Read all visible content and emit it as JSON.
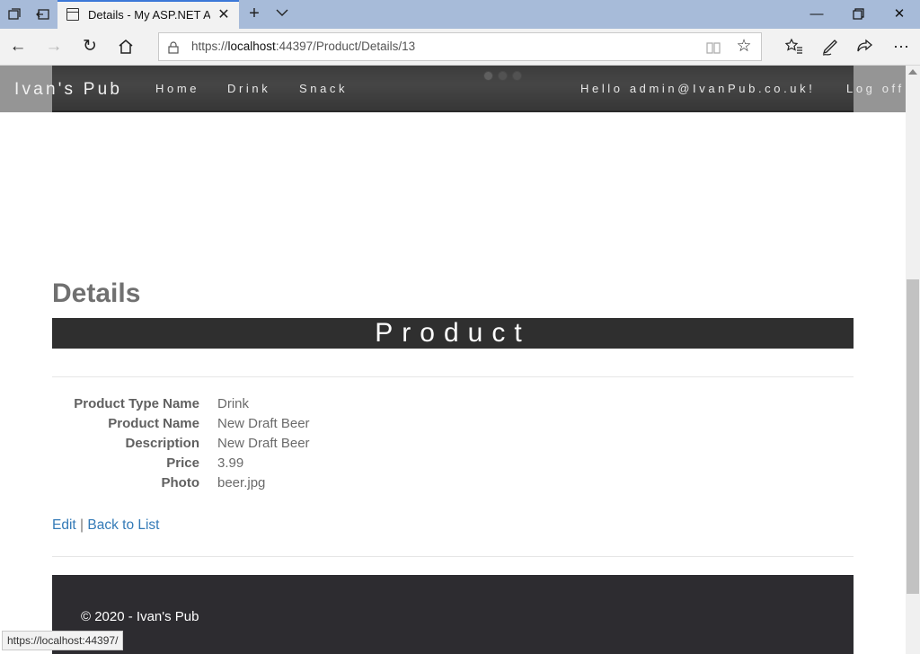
{
  "browser": {
    "tab_title": "Details - My ASP.NET Ap",
    "url_scheme": "https://",
    "url_host": "localhost",
    "url_rest": ":44397/Product/Details/13",
    "status_url": "https://localhost:44397/",
    "icons": [
      "tab-set-aside-icon",
      "tab-back-icon",
      "page-icon",
      "close-icon",
      "new-tab-icon",
      "chevron-down-icon",
      "minimize-icon",
      "restore-icon",
      "close-window-icon",
      "back-icon",
      "forward-icon",
      "refresh-icon",
      "home-icon",
      "lock-icon",
      "reading-view-icon",
      "star-icon",
      "favorites-icon",
      "pen-icon",
      "share-icon",
      "more-icon"
    ]
  },
  "navbar": {
    "brand": "Ivan's Pub",
    "links": [
      "Home",
      "Drink",
      "Snack"
    ],
    "greeting": "Hello admin@IvanPub.co.uk!",
    "logoff": "Log off"
  },
  "main": {
    "title": "Details",
    "band": "Product",
    "fields": [
      {
        "label": "Product Type Name",
        "value": "Drink"
      },
      {
        "label": "Product Name",
        "value": "New Draft Beer"
      },
      {
        "label": "Description",
        "value": "New Draft Beer"
      },
      {
        "label": "Price",
        "value": "3.99"
      },
      {
        "label": "Photo",
        "value": "beer.jpg"
      }
    ],
    "actions": {
      "edit": "Edit",
      "separator": "|",
      "back": "Back to List"
    }
  },
  "footer": {
    "text": "© 2020 - Ivan's Pub"
  },
  "colors": {
    "link": "#337ab7",
    "footer_bg": "#2d2c30",
    "band_bg": "#2f2f2f",
    "tabbar": "#a7bbd9"
  }
}
